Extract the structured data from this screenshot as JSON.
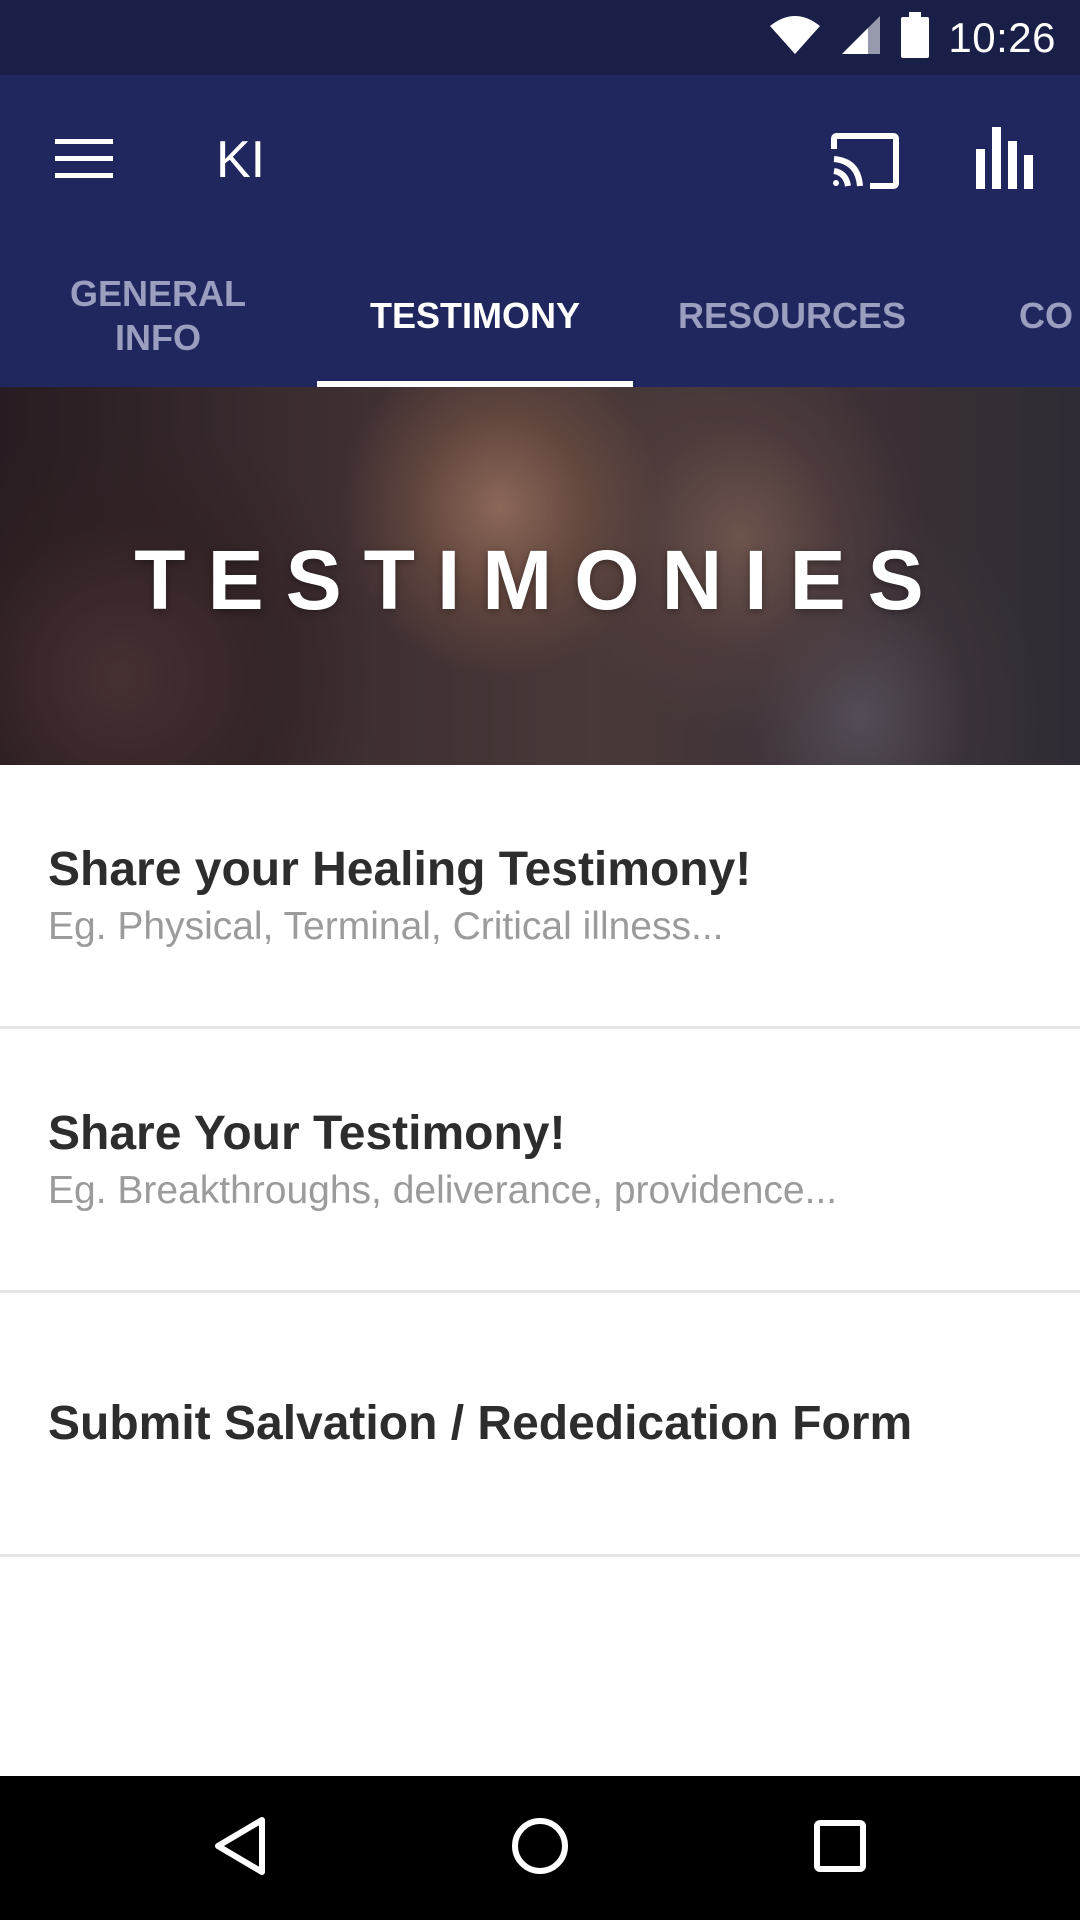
{
  "status_bar": {
    "time": "10:26",
    "icons": [
      "wifi-icon",
      "cell-signal-icon",
      "battery-icon"
    ]
  },
  "app_bar": {
    "title": "KI",
    "icons": [
      "hamburger-menu-icon",
      "cast-icon",
      "bar-chart-icon"
    ]
  },
  "tabs": [
    {
      "label": "GENERAL\nINFO",
      "active": false
    },
    {
      "label": "TESTIMONY",
      "active": true
    },
    {
      "label": "RESOURCES",
      "active": false
    },
    {
      "label": "CO",
      "active": false
    }
  ],
  "hero": {
    "title": "TESTIMONIES"
  },
  "list": [
    {
      "title": "Share your Healing Testimony!",
      "subtitle": "Eg. Physical, Terminal, Critical illness..."
    },
    {
      "title": "Share Your Testimony!",
      "subtitle": "Eg. Breakthroughs, deliverance, providence..."
    },
    {
      "title": "Submit Salvation / Rededication Form",
      "subtitle": ""
    }
  ],
  "nav_bar": {
    "icons": [
      "back-icon",
      "home-icon",
      "recents-icon"
    ]
  },
  "colors": {
    "status_bar": "#1a1f47",
    "app_bar": "#20275e",
    "tab_inactive": "#9a9fc0",
    "tab_active": "#ffffff"
  }
}
